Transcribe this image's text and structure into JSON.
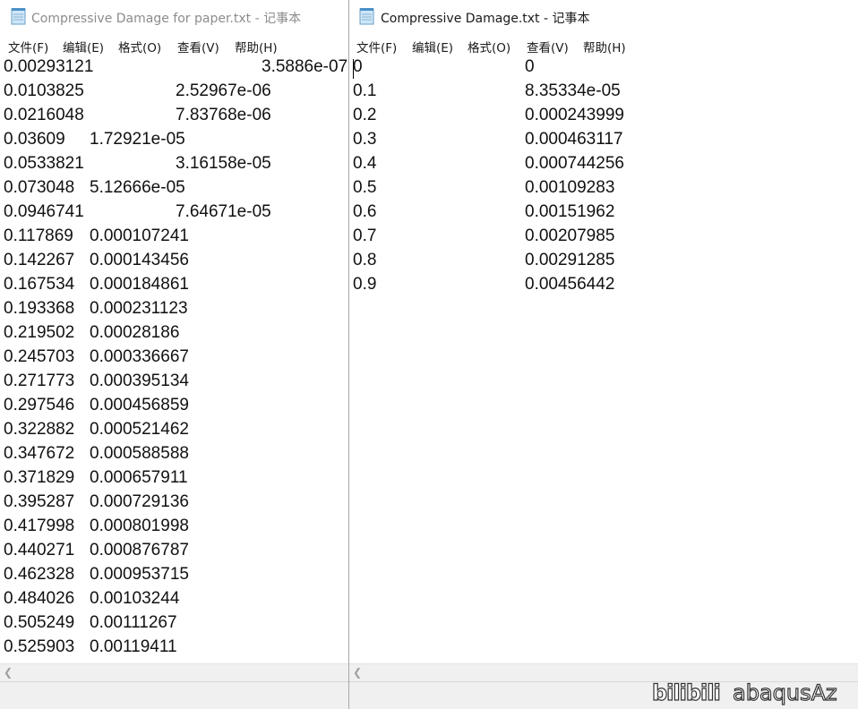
{
  "windows": {
    "left": {
      "title": "Compressive Damage for paper.txt - 记事本",
      "menu": [
        "文件(F)",
        "编辑(E)",
        "格式(O)",
        "查看(V)",
        "帮助(H)"
      ],
      "lines": [
        "0.00293121\t\t3.5886e-07",
        "0.0103825\t\t2.52967e-06",
        "0.0216048\t\t7.83768e-06",
        "0.03609\t1.72921e-05",
        "0.0533821\t\t3.16158e-05",
        "0.073048\t5.12666e-05",
        "0.0946741\t\t7.64671e-05",
        "0.117869\t0.000107241",
        "0.142267\t0.000143456",
        "0.167534\t0.000184861",
        "0.193368\t0.000231123",
        "0.219502\t0.00028186",
        "0.245703\t0.000336667",
        "0.271773\t0.000395134",
        "0.297546\t0.000456859",
        "0.322882\t0.000521462",
        "0.347672\t0.000588588",
        "0.371829\t0.000657911",
        "0.395287\t0.000729136",
        "0.417998\t0.000801998",
        "0.440271\t0.000876787",
        "0.462328\t0.000953715",
        "0.484026\t0.00103244",
        "0.505249\t0.00111267",
        "0.525903\t0.00119411"
      ]
    },
    "right": {
      "title": "Compressive Damage.txt - 记事本",
      "menu": [
        "文件(F)",
        "编辑(E)",
        "格式(O)",
        "查看(V)",
        "帮助(H)"
      ],
      "lines": [
        "0\t\t0",
        "0.1\t\t8.35334e-05",
        "0.2\t\t0.000243999",
        "0.3\t\t0.000463117",
        "0.4\t\t0.000744256",
        "0.5\t\t0.00109283",
        "0.6\t\t0.00151962",
        "0.7\t\t0.00207985",
        "0.8\t\t0.00291285",
        "0.9\t\t0.00456442"
      ]
    }
  },
  "watermark": {
    "logo": "bilibili",
    "user": "abaqusAz"
  }
}
